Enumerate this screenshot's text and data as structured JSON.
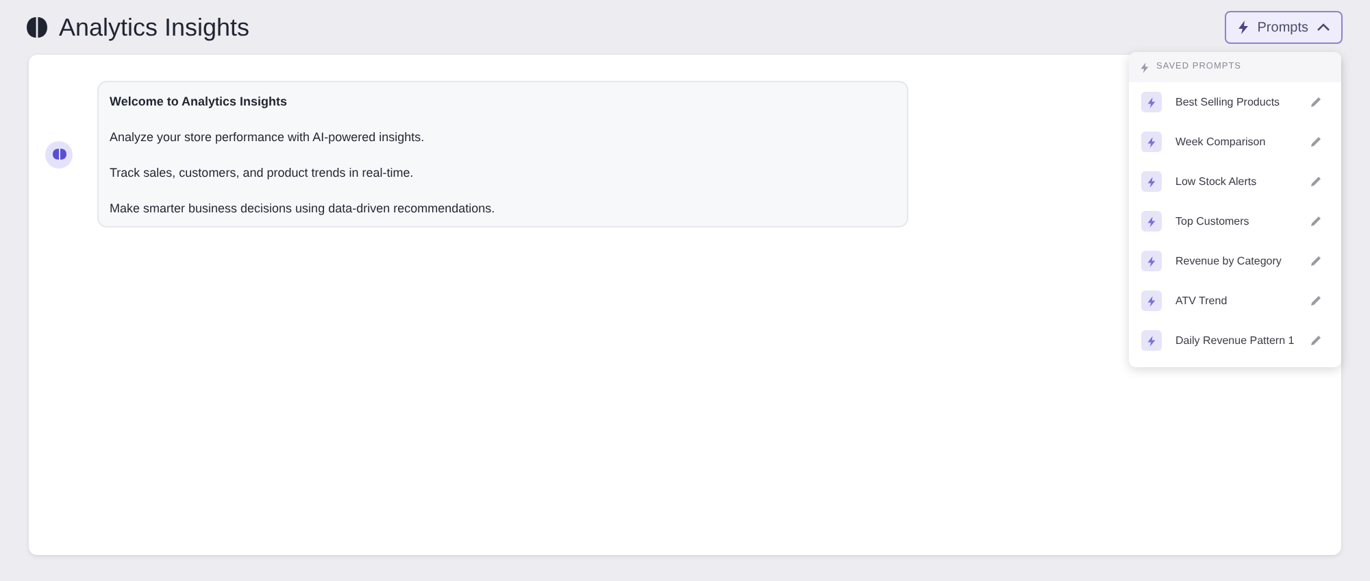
{
  "header": {
    "title": "Analytics Insights",
    "prompts_button": {
      "label": "Prompts",
      "expanded": true
    }
  },
  "message": {
    "title": "Welcome to Analytics Insights",
    "paragraphs": [
      "Analyze your store performance with AI-powered insights.",
      "Track sales, customers, and product trends in real-time.",
      "Make smarter business decisions using data-driven recommendations."
    ]
  },
  "saved_prompts": {
    "heading": "SAVED PROMPTS",
    "items": [
      {
        "label": "Best Selling Products"
      },
      {
        "label": "Week Comparison"
      },
      {
        "label": "Low Stock Alerts"
      },
      {
        "label": "Top Customers"
      },
      {
        "label": "Revenue by Category"
      },
      {
        "label": "ATV Trend"
      },
      {
        "label": "Daily Revenue Pattern 1"
      }
    ]
  }
}
